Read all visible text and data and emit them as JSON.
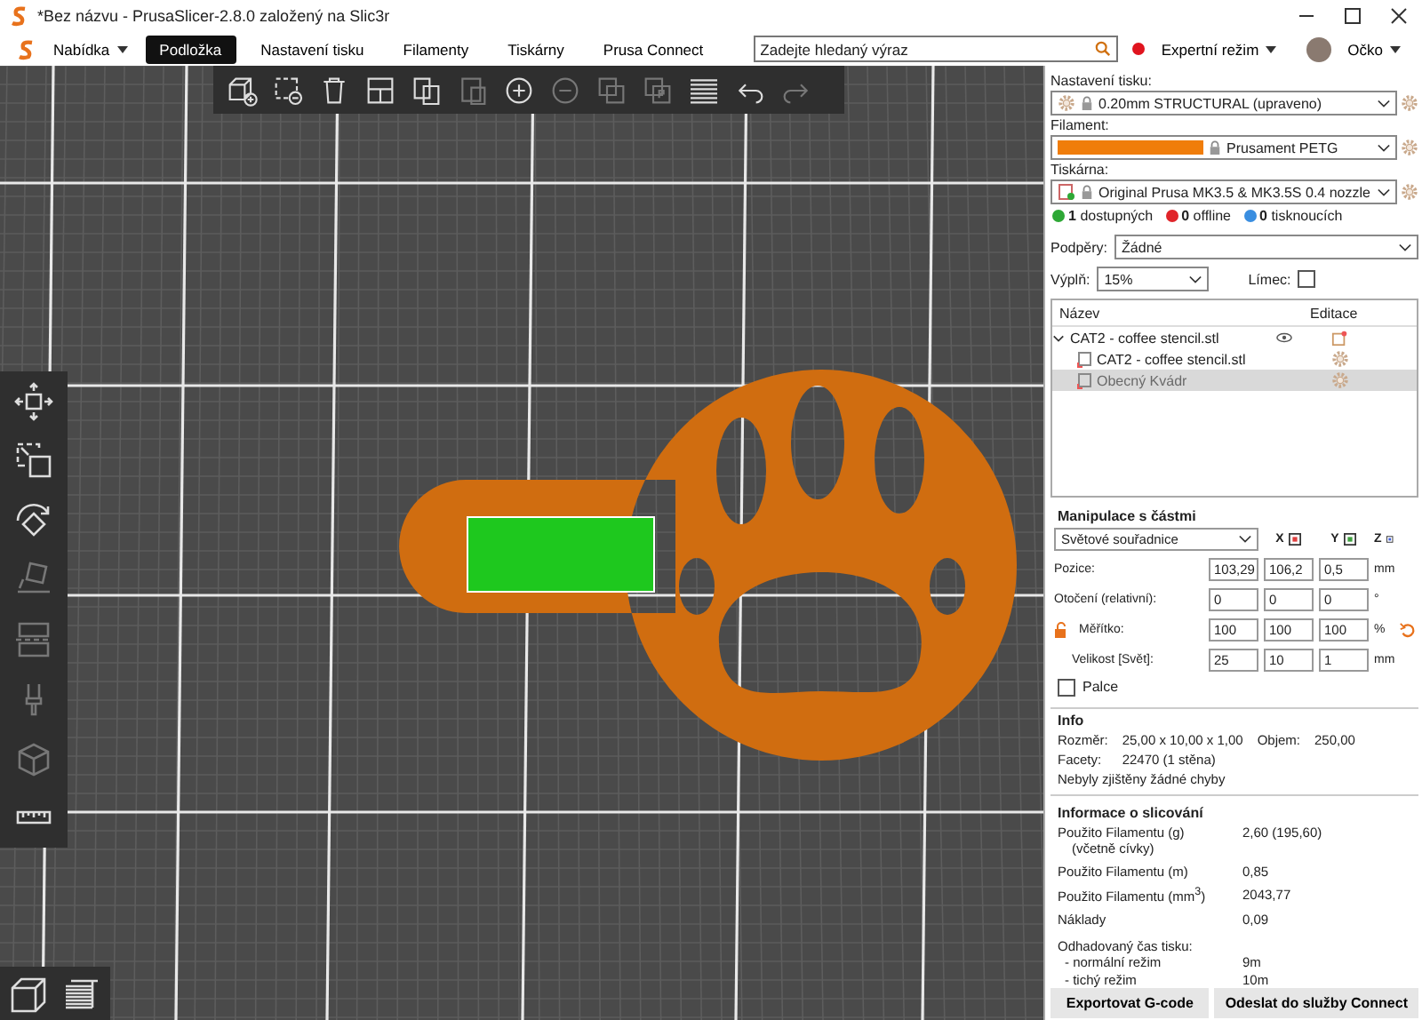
{
  "window": {
    "title": "*Bez názvu - PrusaSlicer-2.8.0 založený na Slic3r"
  },
  "menubar": {
    "menu": "Nabídka",
    "tabs": [
      {
        "label": "Podložka",
        "selected": true
      },
      {
        "label": "Nastavení tisku",
        "selected": false
      },
      {
        "label": "Filamenty",
        "selected": false
      },
      {
        "label": "Tiskárny",
        "selected": false
      },
      {
        "label": "Prusa Connect",
        "selected": false
      }
    ],
    "search": {
      "placeholder": "Zadejte hledaný výraz"
    },
    "mode": {
      "label": "Expertní režim",
      "color": "#e0141e"
    },
    "user": "Očko"
  },
  "sidebar": {
    "presets": [
      {
        "kind": "print",
        "label": "Nastavení tisku:",
        "value": "0.20mm STRUCTURAL (upraveno)"
      },
      {
        "kind": "filament",
        "label": "Filament:",
        "value": "Prusament PETG",
        "color": "#f07d0a"
      },
      {
        "kind": "printer",
        "label": "Tiskárna:",
        "value": "Original Prusa MK3.5 & MK3.5S 0.4 nozzle"
      }
    ],
    "printer_status": [
      {
        "count": "1",
        "label": "dostupných",
        "color": "#2ea836"
      },
      {
        "count": "0",
        "label": "offline",
        "color": "#e0242a"
      },
      {
        "count": "0",
        "label": "tisknoucích",
        "color": "#3a8ee0"
      }
    ],
    "supports": {
      "label": "Podpěry:",
      "value": "Žádné"
    },
    "infill": {
      "label": "Výplň:",
      "value": "15%"
    },
    "brim": {
      "label": "Límec:",
      "checked": false
    },
    "object_list": {
      "columns": [
        "Název",
        "Editace"
      ],
      "objects": [
        {
          "name": "CAT2 - coffee stencil.stl",
          "expanded": true,
          "selected": false,
          "children": [
            {
              "name": "CAT2 - coffee stencil.stl",
              "selected": false
            },
            {
              "name": "Obecný Kvádr",
              "selected": true
            }
          ]
        }
      ]
    },
    "manipulation": {
      "title": "Manipulace s částmi",
      "coordinates": "Světové souřadnice",
      "axes": [
        "X",
        "Y",
        "Z"
      ],
      "rows": [
        {
          "label": "Pozice:",
          "values": [
            "103,29",
            "106,2",
            "0,5"
          ],
          "unit": "mm"
        },
        {
          "label": "Otočení (relativní):",
          "values": [
            "0",
            "0",
            "0"
          ],
          "unit": "°"
        },
        {
          "label": "Měřítko:",
          "values": [
            "100",
            "100",
            "100"
          ],
          "unit": "%"
        },
        {
          "label": "Velikost [Svět]:",
          "values": [
            "25",
            "10",
            "1"
          ],
          "unit": "mm"
        }
      ],
      "inches": {
        "label": "Palce",
        "checked": false
      }
    },
    "info": {
      "title": "Info",
      "size_label": "Rozměr:",
      "size": "25,00 x 10,00 x 1,00",
      "volume_label": "Objem:",
      "volume": "250,00",
      "facets_label": "Facety:",
      "facets": "22470 (1 stěna)",
      "errors": "Nebyly zjištěny žádné chyby"
    },
    "slice_info": {
      "title": "Informace o slicování",
      "rows": [
        {
          "label": "Použito Filamentu (g)",
          "sublabel": "(včetně cívky)",
          "value": "2,60 (195,60)"
        },
        {
          "label": "Použito Filamentu (m)",
          "value": "0,85"
        },
        {
          "label": "Použito Filamentu (mm$^{3}$)",
          "value": "2043,77"
        },
        {
          "label": "Náklady",
          "value": "0,09"
        }
      ],
      "time_title": "Odhadovaný čas tisku:",
      "times": [
        {
          "label": "- normální režim",
          "value": "9m"
        },
        {
          "label": "- tichý režim",
          "value": "10m"
        }
      ]
    },
    "buttons": [
      "Exportovat G-code",
      "Odeslat do služby Connect"
    ]
  }
}
